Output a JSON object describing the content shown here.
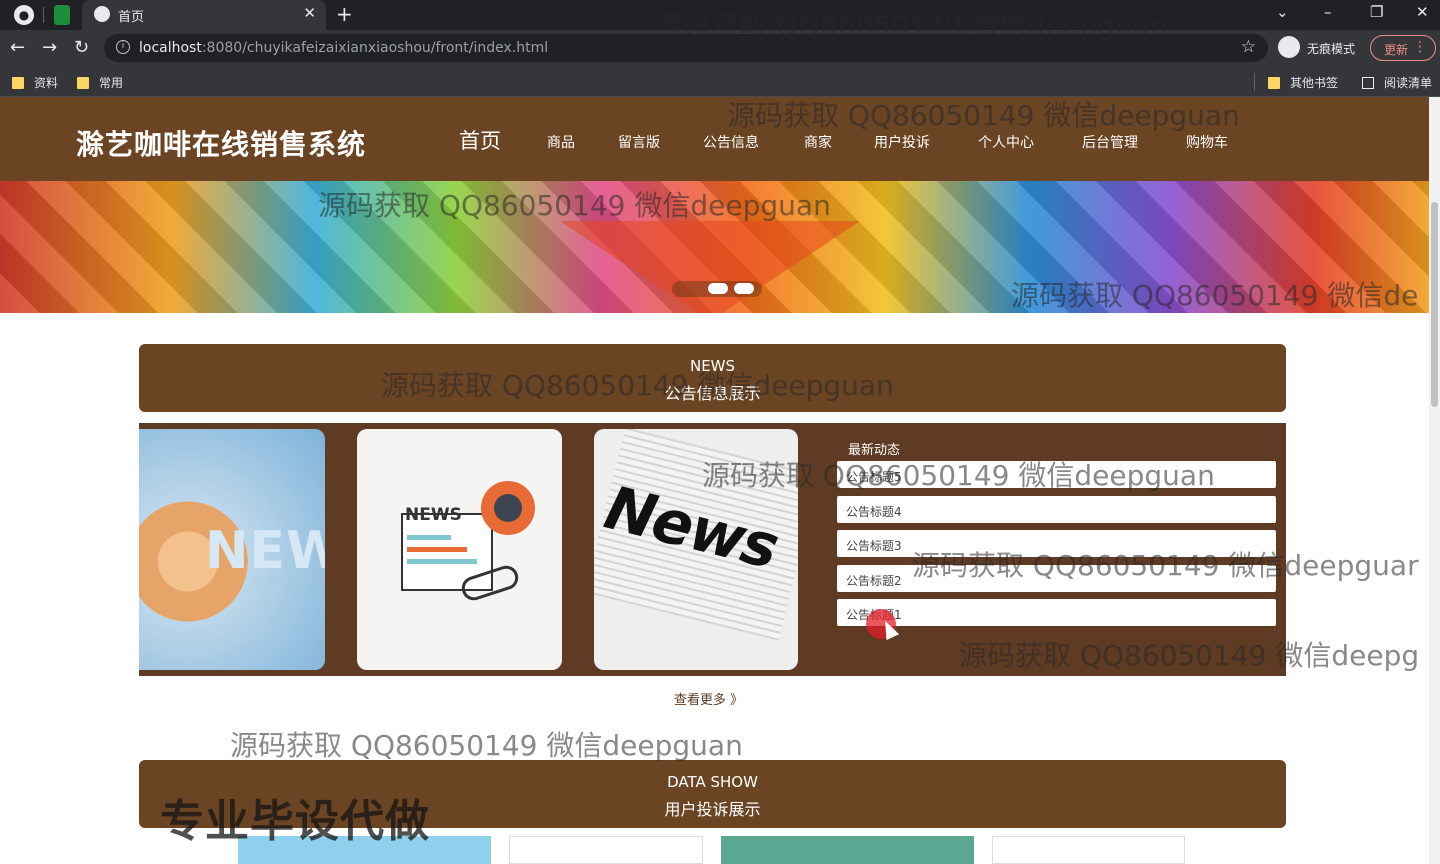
{
  "browser": {
    "tab_title": "首页",
    "url_host": "localhost",
    "url_path": ":8080/chuyikafeizaixianxiaoshou/front/index.html",
    "incognito_label": "无痕模式",
    "update_label": "更新",
    "bookmarks": [
      "资料",
      "常用"
    ],
    "other_bookmarks": "其他书签",
    "reading_list": "阅读清单"
  },
  "site": {
    "logo": "滁艺咖啡在线销售系统",
    "nav": [
      "首页",
      "商品",
      "留言版",
      "公告信息",
      "商家",
      "用户投诉",
      "个人中心",
      "后台管理",
      "购物车"
    ]
  },
  "news_section": {
    "title_en": "NEWS",
    "title_cn": "公告信息展示",
    "card_texts": [
      "NEW",
      "NEWS",
      "News"
    ],
    "latest_label": "最新动态",
    "items": [
      "公告标题5",
      "公告标题4",
      "公告标题3",
      "公告标题2",
      "公告标题1"
    ],
    "more": "查看更多 》"
  },
  "data_section": {
    "title_en": "DATA SHOW",
    "title_cn": "用户投诉展示"
  },
  "watermark": "源码获取 QQ86050149 微信deepguan",
  "watermark_cut": [
    "源码获取 QQ86050149 微信de",
    "源码获取 QQ86050149 微信deepguar",
    "源码获取 QQ86050149 微信deepg"
  ],
  "overlay_text": "专业毕设代做",
  "colors": {
    "header_brown": "#6b4424",
    "panel_brown": "#5e3b22",
    "accent_orange": "#e86a35"
  }
}
